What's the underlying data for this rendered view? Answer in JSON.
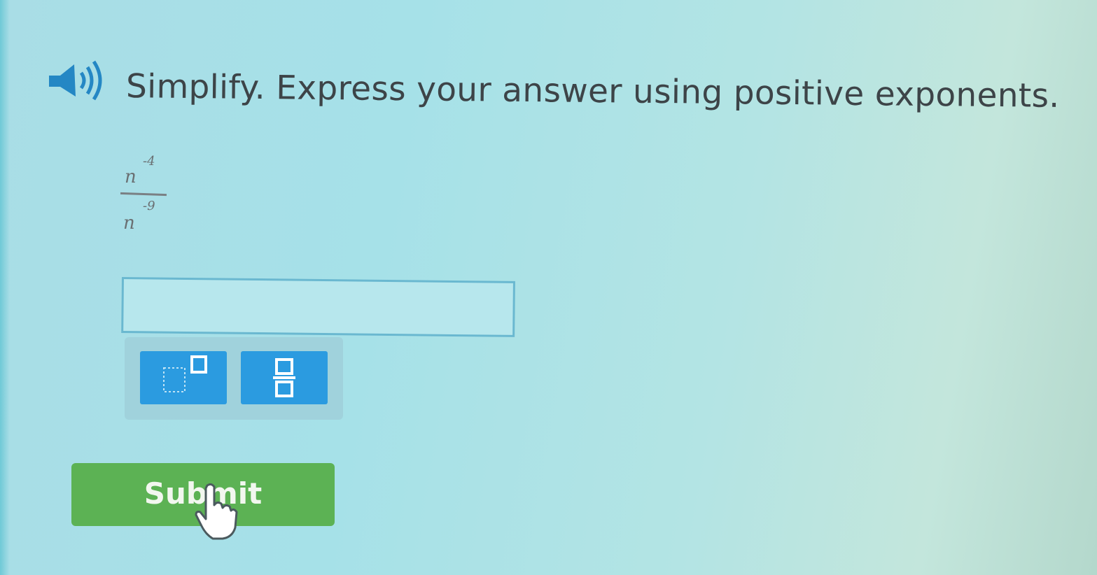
{
  "question": {
    "audio_icon": "speaker-icon",
    "text": "Simplify. Express your answer using positive exponents."
  },
  "expression": {
    "numerator_base": "n",
    "numerator_exponent": "-4",
    "denominator_base": "n",
    "denominator_exponent": "-9"
  },
  "answer": {
    "value": "",
    "placeholder": ""
  },
  "toolbar": {
    "buttons": [
      {
        "name": "exponent-template",
        "icon": "exponent-template-icon"
      },
      {
        "name": "fraction-template",
        "icon": "fraction-template-icon"
      }
    ]
  },
  "submit": {
    "label": "Submit"
  },
  "colors": {
    "background": "#a9dde6",
    "question_text": "#3d4448",
    "input_border": "#6ab8d0",
    "tool_button": "#2b9be0",
    "submit_button": "#5cb254"
  }
}
